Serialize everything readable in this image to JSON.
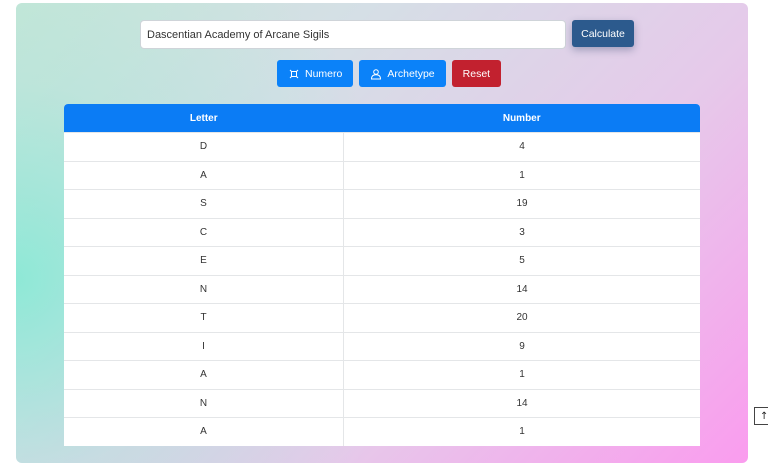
{
  "form": {
    "name_value": "Dascentian Academy of Arcane Sigils",
    "calculate_label": "Calculate"
  },
  "actions": {
    "numero_label": "Numero",
    "archetype_label": "Archetype",
    "reset_label": "Reset"
  },
  "table": {
    "headers": [
      "Letter",
      "Number"
    ],
    "rows": [
      [
        "D",
        "4"
      ],
      [
        "A",
        "1"
      ],
      [
        "S",
        "19"
      ],
      [
        "C",
        "3"
      ],
      [
        "E",
        "5"
      ],
      [
        "N",
        "14"
      ],
      [
        "T",
        "20"
      ],
      [
        "I",
        "9"
      ],
      [
        "A",
        "1"
      ],
      [
        "N",
        "14"
      ],
      [
        "A",
        "1"
      ]
    ]
  },
  "scroll_top": {
    "glyph": "↑"
  },
  "colors": {
    "primary": "#0b82f9",
    "calculate": "#2c5a8d",
    "danger": "#c2212f",
    "table_header": "#0b7cf5"
  },
  "icons": {
    "numero": "numbers-square-icon",
    "archetype": "person-icon",
    "scroll_top": "arrow-up-icon"
  }
}
